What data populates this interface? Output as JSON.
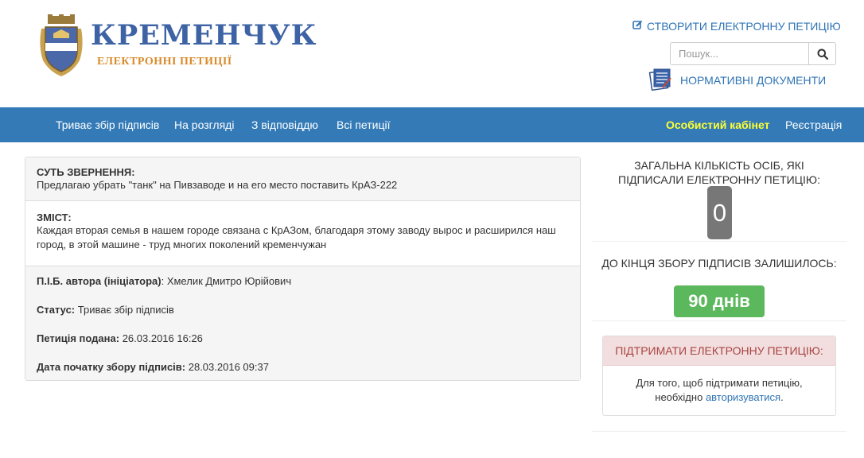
{
  "header": {
    "logo_title": "КРЕМЕНЧУК",
    "logo_subtitle": "ЕЛЕКТРОННІ ПЕТИЦІЇ",
    "create_petition": "СТВОРИТИ ЕЛЕКТРОННУ ПЕТИЦІЮ",
    "search": {
      "placeholder": "Пошук...",
      "value": ""
    },
    "documents": "НОРМАТИВНІ ДОКУМЕНТИ"
  },
  "nav": {
    "items": [
      "Триває збір підписів",
      "На розгляді",
      "З відповіддю",
      "Всі петиції"
    ],
    "cabinet": "Особистий кабінет",
    "register": "Реєстрація"
  },
  "petition": {
    "summary_label": "СУТЬ ЗВЕРНЕННЯ:",
    "summary_text": "Предлагаю убрать \"танк\" на Пивзаводе и на его место поставить КрАЗ-222",
    "content_label": "ЗМІСТ:",
    "content_text": "Каждая вторая семья в нашем городе связана с КрАЗом, благодаря этому заводу вырос и расширился наш город, в этой машине - труд многих поколений кременчужан",
    "author_label": "П.І.Б. автора (ініціатора)",
    "author_value": "Хмелик Дмитро Юрійович",
    "status_label": "Статус:",
    "status_value": "Триває збір підписів",
    "submitted_label": "Петиція подана:",
    "submitted_value": "26.03.2016 16:26",
    "start_label": "Дата початку збору підписів:",
    "start_value": "28.03.2016 09:37"
  },
  "sidebar": {
    "signers_title": "ЗАГАЛЬНА КІЛЬКІСТЬ ОСІБ, ЯКІ ПІДПИСАЛИ ЕЛЕКТРОННУ ПЕТИЦІЮ:",
    "signers_count": "0",
    "remaining_title": "ДО КІНЦЯ ЗБОРУ ПІДПИСІВ ЗАЛИШИЛОСЬ:",
    "remaining_days": "90 днів",
    "support_title": "ПІДТРИМАТИ ЕЛЕКТРОННУ ПЕТИЦІЮ:",
    "support_text_before": "Для того, щоб підтримати петицію, необхідно",
    "support_link": "авторизуватися",
    "support_text_after": "."
  },
  "colors": {
    "nav_bg": "#337ab7",
    "nav_highlight": "#ffff33",
    "link": "#2f74b5",
    "badge_gray": "#777777",
    "badge_green": "#5cb85c",
    "support_head_bg": "#f2dede",
    "support_head_text": "#a94442"
  },
  "icons": {
    "create": "edit-icon",
    "search": "search-icon",
    "documents": "documents-icon",
    "logo": "coat-of-arms-icon"
  }
}
